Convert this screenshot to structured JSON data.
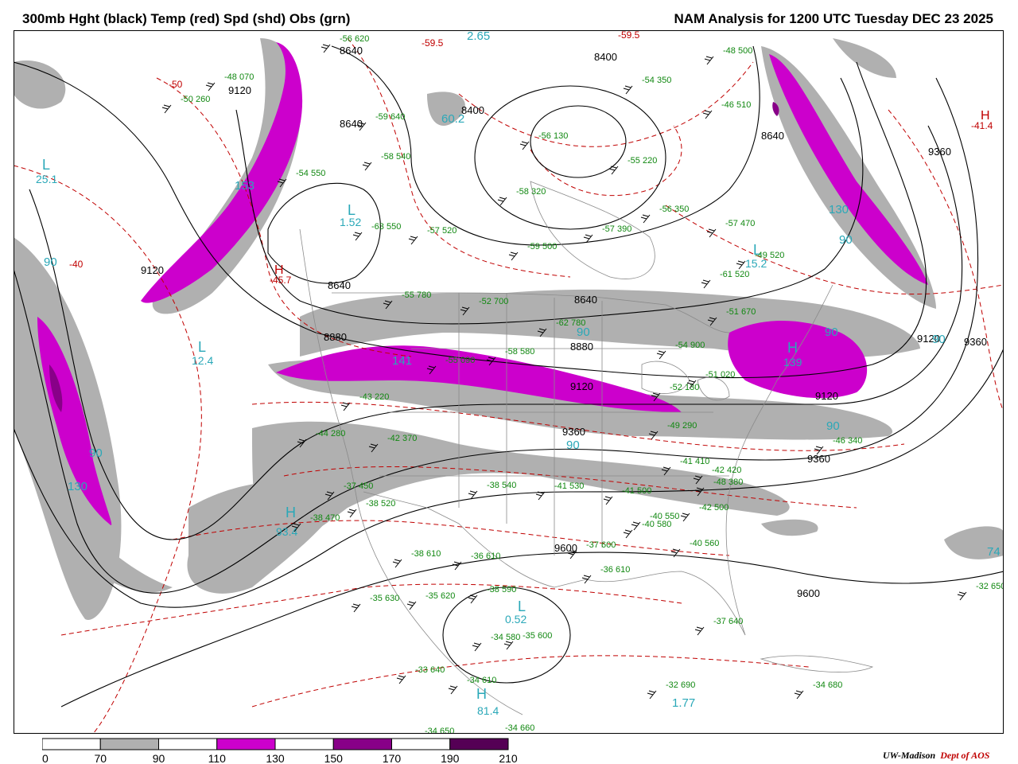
{
  "title_left": "300mb Hght (black) Temp (red) Spd (shd) Obs (grn)",
  "title_right": "NAM Analysis for 1200 UTC Tuesday  DEC 23 2025",
  "credit_left": "UW-Madison",
  "credit_right": "Dept of AOS",
  "colors": {
    "height": "#000000",
    "temp": "#c00000",
    "speed_label": "#2aa8b8",
    "obs": "#118811",
    "shade_70": "#b0b0b0",
    "shade_110": "#cc00cc",
    "shade_150": "#880088",
    "shade_190": "#550055"
  },
  "colorbar": {
    "ticks": [
      "0",
      "70",
      "90",
      "110",
      "130",
      "150",
      "170",
      "190",
      "210"
    ],
    "fills": [
      "#ffffff",
      "#b0b0b0",
      "#ffffff",
      "#cc00cc",
      "#ffffff",
      "#880088",
      "#ffffff",
      "#550055"
    ]
  },
  "height_labels": [
    "8640",
    "8400",
    "8400",
    "8640",
    "9120",
    "8640",
    "9120",
    "8880",
    "8640",
    "8880",
    "9120",
    "9360",
    "9360",
    "9120",
    "9120",
    "9360",
    "9360",
    "9600",
    "9600",
    "8640"
  ],
  "temp_labels": [
    "-50",
    "-40",
    "-59.5",
    "-41.4",
    "-45.7",
    "-59.5"
  ],
  "center_labels": [
    {
      "letter": "L",
      "value": "25.1"
    },
    {
      "letter": "L",
      "value": "1.52"
    },
    {
      "letter": "L",
      "value": "12.4"
    },
    {
      "letter": "L",
      "value": "15.2"
    },
    {
      "letter": "L",
      "value": "0.52"
    },
    {
      "letter": "H",
      "value": "93.4"
    },
    {
      "letter": "H",
      "value": "81.4"
    },
    {
      "letter": "H",
      "value": "139"
    },
    {
      "letter": "H",
      "value": "-45.7"
    },
    {
      "letter": "H",
      "value": "-41.4"
    }
  ],
  "speed_labels": [
    "2.65",
    "90",
    "130",
    "90",
    "90",
    "90",
    "90",
    "74",
    "1.77",
    "60.2",
    "90",
    "90",
    "141",
    "153",
    "130",
    "90"
  ],
  "obs": [
    "-56 620",
    "-48 070",
    "-50 260",
    "-59 640",
    "-54 550",
    "-58 540",
    "-63 550",
    "-57 520",
    "-55 220",
    "-54 350",
    "-46 510",
    "-48 500",
    "-57 470",
    "-49 520",
    "-61 520",
    "-55 780",
    "-52 700",
    "-62 780",
    "-54 900",
    "-51 670",
    "-43 220",
    "-44 280",
    "-42 370",
    "-37 450",
    "-38 470",
    "-38 520",
    "-38 540",
    "-41 530",
    "-41 500",
    "-40 550",
    "-40 560",
    "-40 580",
    "-38 610",
    "-36 610",
    "-35 630",
    "-35 620",
    "-38 590",
    "-34 580",
    "-35 600",
    "-33 640",
    "-34 610",
    "-34 650",
    "-34 660",
    "-34 680",
    "-32 650",
    "-32 690",
    "-36 610",
    "-37 600",
    "-37 640",
    "-46 340",
    "-42 500",
    "-42 420",
    "-41 410",
    "-48 380",
    "-49 290",
    "-52 130",
    "-51 020",
    "-56 130",
    "-58 320",
    "-59 500",
    "-57 390",
    "-56 350",
    "-58 580",
    "-55 090"
  ]
}
